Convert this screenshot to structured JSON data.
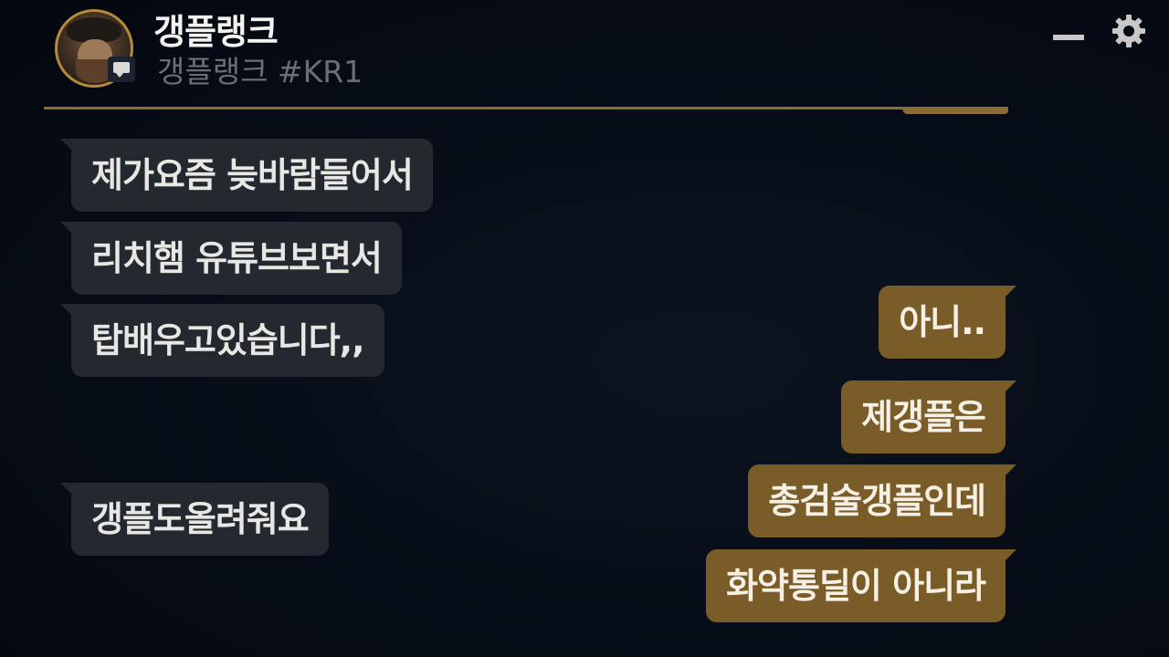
{
  "header": {
    "display_name": "갱플랭크",
    "riot_id": "갱플랭크 #KR1"
  },
  "icons": {
    "minimize": "minimize-icon",
    "settings": "gear-icon",
    "chat_badge": "chat-bubble-icon"
  },
  "colors": {
    "background": "#060c16",
    "accent_gold": "#8a6b35",
    "incoming_bubble": "#24292f",
    "outgoing_bubble": "#7a5c28"
  },
  "messages": {
    "incoming": [
      {
        "text": "제가요즘 늦바람들어서"
      },
      {
        "text": "리치햄 유튜브보면서"
      },
      {
        "text": "탑배우고있습니다,,"
      },
      {
        "text": "갱플도올려줘요"
      }
    ],
    "outgoing": [
      {
        "text": "아니.."
      },
      {
        "text": "제갱플은"
      },
      {
        "text": "총검술갱플인데"
      },
      {
        "text": "화약통딜이 아니라"
      }
    ]
  }
}
